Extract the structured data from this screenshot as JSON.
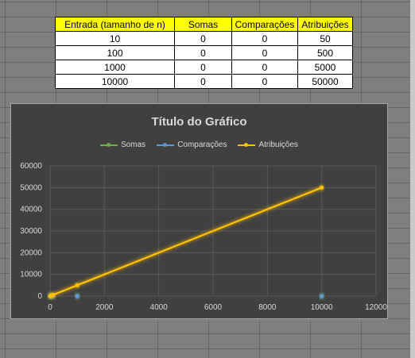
{
  "table": {
    "headers": [
      "Entrada (tamanho de n)",
      "Somas",
      "Comparações",
      "Atribuições"
    ],
    "rows": [
      [
        "10",
        "0",
        "0",
        "50"
      ],
      [
        "100",
        "0",
        "0",
        "500"
      ],
      [
        "1000",
        "0",
        "0",
        "5000"
      ],
      [
        "10000",
        "0",
        "0",
        "50000"
      ]
    ],
    "header_color": "#ffff00"
  },
  "chart_data": {
    "type": "scatter",
    "title": "Título do Gráfico",
    "legend_placement": "top",
    "grid": true,
    "xlim": [
      0,
      12000
    ],
    "ylim": [
      0,
      60000
    ],
    "x_ticks": [
      0,
      2000,
      4000,
      6000,
      8000,
      10000,
      12000
    ],
    "y_ticks": [
      0,
      10000,
      20000,
      30000,
      40000,
      50000,
      60000
    ],
    "x": [
      10,
      100,
      1000,
      10000
    ],
    "series": [
      {
        "name": "Somas",
        "values": [
          0,
          0,
          0,
          0
        ],
        "color": "#70ad47"
      },
      {
        "name": "Comparações",
        "values": [
          0,
          0,
          0,
          0
        ],
        "color": "#5b9bd5"
      },
      {
        "name": "Atribuições",
        "values": [
          50,
          500,
          5000,
          50000
        ],
        "color": "#ffc000"
      }
    ]
  }
}
